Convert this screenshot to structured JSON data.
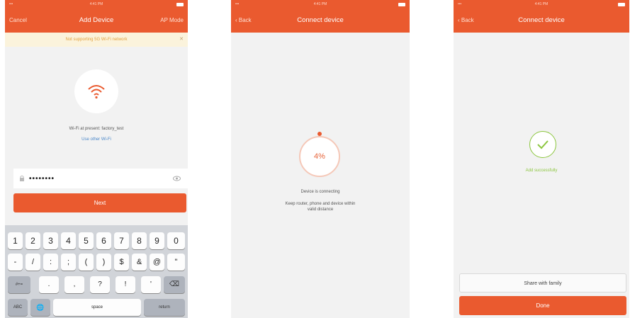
{
  "colors": {
    "accent": "#ea5a2f",
    "success": "#8cc63f",
    "link": "#4a87c9",
    "notice_bg": "#fbf3dc"
  },
  "screen1": {
    "status_time": "4:41 PM",
    "nav": {
      "left": "Cancel",
      "title": "Add Device",
      "right": "AP Mode"
    },
    "notice": "Not supporting 5G Wi-Fi network",
    "wifi_name": "Wi-Fi at present: factory_test",
    "use_other_wifi": "Use other Wi-Fi",
    "password_value": "••••••••",
    "next_label": "Next",
    "keyboard": {
      "row1": [
        "1",
        "2",
        "3",
        "4",
        "5",
        "6",
        "7",
        "8",
        "9",
        "0"
      ],
      "row2": [
        "-",
        "/",
        ":",
        ";",
        "(",
        ")",
        "$",
        "&",
        "@",
        "\""
      ],
      "row3": [
        "#+=",
        ".",
        ",",
        "?",
        "!",
        "'",
        "⌫"
      ],
      "row4": [
        "ABC",
        "🌐",
        "space",
        "return"
      ]
    }
  },
  "screen2": {
    "status_time": "4:41 PM",
    "nav": {
      "left": "‹ Back",
      "title": "Connect device"
    },
    "progress_text": "4%",
    "status_line1": "Device is connecting",
    "status_line2": "Keep router, phone and device within",
    "status_line3": "valid distance"
  },
  "screen3": {
    "status_time": "4:41 PM",
    "nav": {
      "left": "‹ Back",
      "title": "Connect device"
    },
    "success_text": "Add successfully",
    "share_label": "Share with family",
    "done_label": "Done"
  }
}
